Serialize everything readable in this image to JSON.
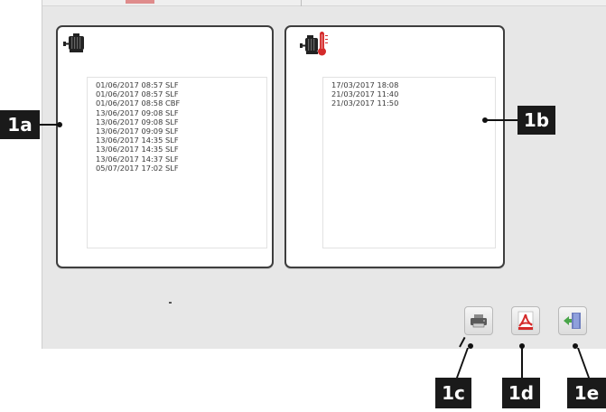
{
  "panel_a": {
    "icon": "motor-icon",
    "entries": [
      "01/06/2017 08:57 SLF",
      "01/06/2017 08:57 SLF",
      "01/06/2017 08:58 CBF",
      "13/06/2017 09:08 SLF",
      "13/06/2017 09:08 SLF",
      "13/06/2017 09:09 SLF",
      "13/06/2017 14:35 SLF",
      "13/06/2017 14:35 SLF",
      "13/06/2017 14:37 SLF",
      "05/07/2017 17:02 SLF"
    ]
  },
  "panel_b": {
    "icon": "motor-thermometer-icon",
    "entries": [
      "17/03/2017 18:08",
      "21/03/2017 11:40",
      "21/03/2017 11:50"
    ]
  },
  "toolbar": {
    "print_icon": "printer-icon",
    "pdf_icon": "pdf-icon",
    "exit_icon": "exit-icon"
  },
  "callouts": {
    "a": "1a",
    "b": "1b",
    "c": "1c",
    "d": "1d",
    "e": "1e"
  },
  "colors": {
    "panel_border": "#3e3e3e",
    "screen_bg": "#e7e7e7",
    "pdf_red": "#d42a2a",
    "exit_green": "#4aa64a"
  }
}
